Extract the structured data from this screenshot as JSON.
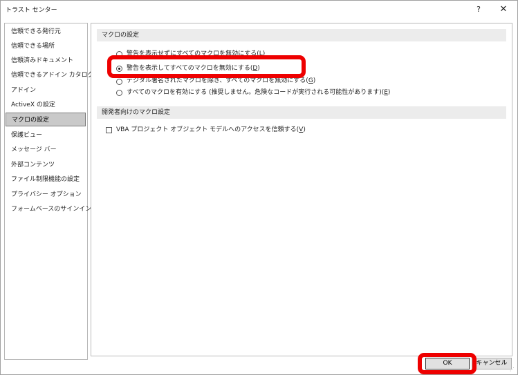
{
  "window": {
    "title": "トラスト センター",
    "help_label": "?",
    "close_label": "✕"
  },
  "sidebar": {
    "items": [
      {
        "label": "信頼できる発行元"
      },
      {
        "label": "信頼できる場所"
      },
      {
        "label": "信頼済みドキュメント"
      },
      {
        "label": "信頼できるアドイン カタログ"
      },
      {
        "label": "アドイン"
      },
      {
        "label": "ActiveX の設定"
      },
      {
        "label": "マクロの設定"
      },
      {
        "label": "保護ビュー"
      },
      {
        "label": "メッセージ バー"
      },
      {
        "label": "外部コンテンツ"
      },
      {
        "label": "ファイル制限機能の設定"
      },
      {
        "label": "プライバシー オプション"
      },
      {
        "label": "フォームベースのサインイン"
      }
    ],
    "selected_label": "マクロの設定"
  },
  "macro_settings": {
    "header": "マクロの設定",
    "options": [
      {
        "text": "警告を表示せずにすべてのマクロを無効にする",
        "key": "L",
        "checked": false
      },
      {
        "text": "警告を表示してすべてのマクロを無効にする",
        "key": "D",
        "checked": true
      },
      {
        "text": "デジタル署名されたマクロを除き、すべてのマクロを無効にする",
        "key": "G",
        "checked": false
      },
      {
        "text": "すべてのマクロを有効にする (推奨しません。危険なコードが実行される可能性があります)",
        "key": "E",
        "checked": false
      }
    ]
  },
  "developer_settings": {
    "header": "開発者向けのマクロ設定",
    "vba_text": "VBA プロジェクト オブジェクト モデルへのアクセスを信頼する",
    "vba_key": "V",
    "vba_checked": false
  },
  "footer": {
    "ok_label": "OK",
    "cancel_label": "キャンセル"
  },
  "colors": {
    "highlight": "#ee0000",
    "selected_bg": "#c9c9c9",
    "section_bg": "#ececec"
  }
}
